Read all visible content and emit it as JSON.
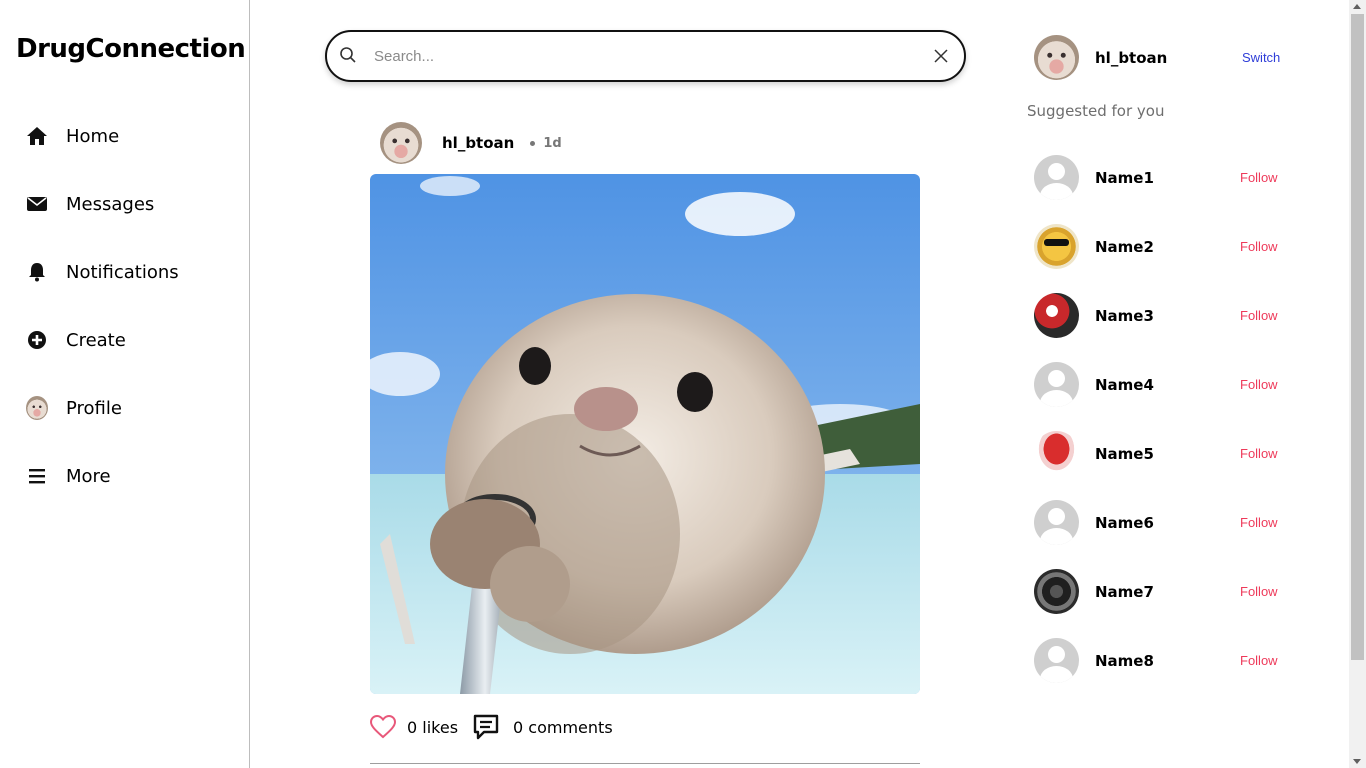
{
  "app": {
    "brand": "DrugConnection"
  },
  "sidebar": {
    "items": [
      {
        "label": "Home",
        "icon": "home-icon"
      },
      {
        "label": "Messages",
        "icon": "envelope-icon"
      },
      {
        "label": "Notifications",
        "icon": "bell-icon"
      },
      {
        "label": "Create",
        "icon": "plus-circle-icon"
      },
      {
        "label": "Profile",
        "icon": "profile-avatar"
      },
      {
        "label": "More",
        "icon": "menu-icon"
      }
    ]
  },
  "search": {
    "placeholder": "Search...",
    "value": ""
  },
  "post": {
    "username": "hl_btoan",
    "time": "1d",
    "likes": "0 likes",
    "comments": "0 comments",
    "image": "otter-selfie-photo"
  },
  "current_user": {
    "username": "hl_btoan",
    "switch_label": "Switch"
  },
  "suggestions": {
    "title": "Suggested for you",
    "follow_label": "Follow",
    "users": [
      {
        "name": "Name1",
        "avatar": "default"
      },
      {
        "name": "Name2",
        "avatar": "emoji-sunglasses"
      },
      {
        "name": "Name3",
        "avatar": "red-abstract"
      },
      {
        "name": "Name4",
        "avatar": "default"
      },
      {
        "name": "Name5",
        "avatar": "cake"
      },
      {
        "name": "Name6",
        "avatar": "default"
      },
      {
        "name": "Name7",
        "avatar": "dark-abstract"
      },
      {
        "name": "Name8",
        "avatar": "default"
      }
    ]
  },
  "colors": {
    "follow": "#ee3a5a",
    "switch": "#2f3ed8",
    "like_heart": "#e8587a"
  }
}
